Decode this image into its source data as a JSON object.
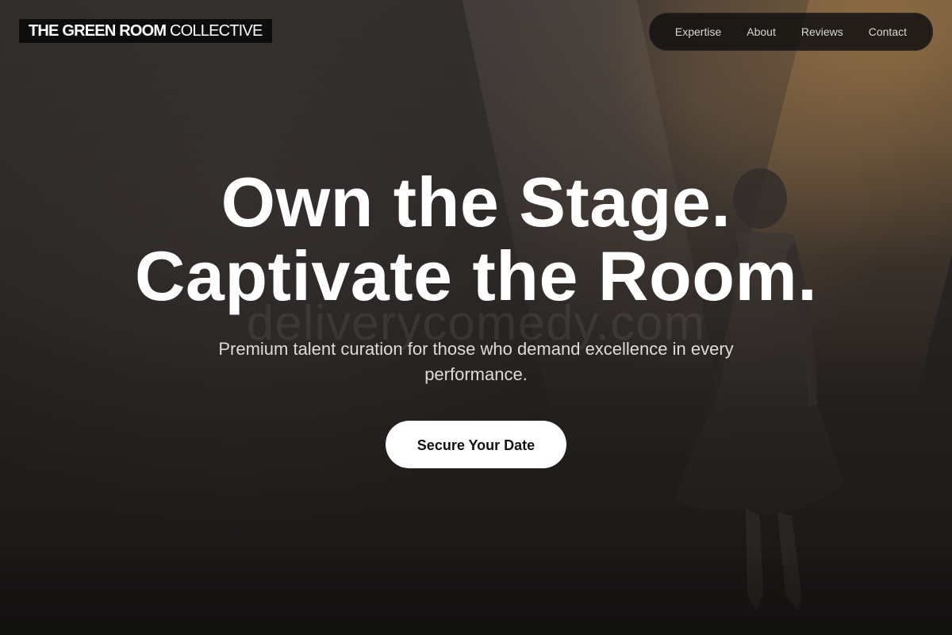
{
  "brand": {
    "name_bold": "THE GREEN ROOM",
    "name_light": "COLLECTIVE"
  },
  "nav": {
    "items": [
      {
        "label": "Expertise"
      },
      {
        "label": "About"
      },
      {
        "label": "Reviews"
      },
      {
        "label": "Contact"
      }
    ]
  },
  "hero": {
    "headline_line1": "Own the Stage.",
    "headline_line2": "Captivate the Room.",
    "subtitle": "Premium talent curation for those who demand excellence in every performance.",
    "cta_label": "Secure Your Date",
    "watermark": "deliverycomedy.com"
  },
  "colors": {
    "background": "#2e2a29",
    "accent_light": "#d6a05c",
    "logo_bg": "#0d0d0d",
    "cta_bg": "#ffffff",
    "cta_text": "#111111"
  }
}
